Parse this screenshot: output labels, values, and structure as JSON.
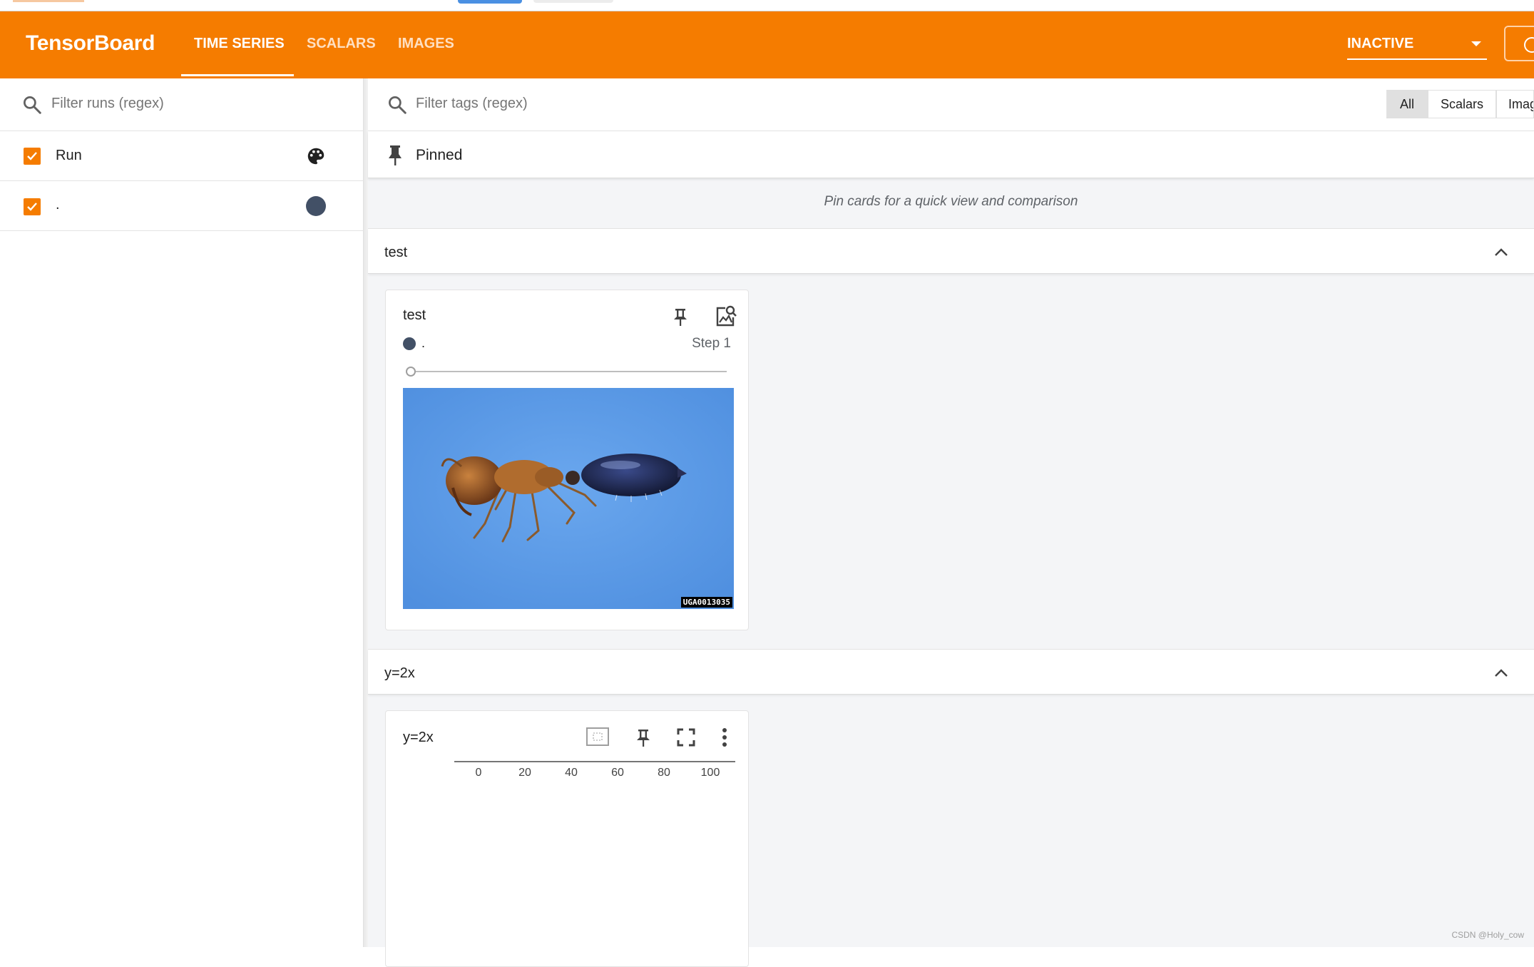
{
  "app": {
    "title": "TensorBoard",
    "tabs": [
      {
        "label": "TIME SERIES",
        "active": true
      },
      {
        "label": "SCALARS",
        "active": false
      },
      {
        "label": "IMAGES",
        "active": false
      }
    ],
    "reload_status": "INACTIVE"
  },
  "sidebar": {
    "filter_placeholder": "Filter runs (regex)",
    "runs": [
      {
        "label": "Run",
        "checked": true,
        "icon": "palette-icon"
      },
      {
        "label": ".",
        "checked": true,
        "color": "#425066"
      }
    ]
  },
  "main": {
    "tag_filter_placeholder": "Filter tags (regex)",
    "type_toggles": [
      {
        "label": "All",
        "selected": true
      },
      {
        "label": "Scalars",
        "selected": false
      },
      {
        "label": "Imag",
        "selected": false
      }
    ],
    "pinned": {
      "title": "Pinned",
      "empty_message": "Pin cards for a quick view and comparison"
    },
    "groups": [
      {
        "title": "test",
        "card": {
          "title": "test",
          "run": ".",
          "step": "Step 1",
          "image_caption": "UGA0013035"
        }
      },
      {
        "title": "y=2x",
        "card": {
          "title": "y=2x",
          "x_ticks": [
            "0",
            "20",
            "40",
            "60",
            "80",
            "100"
          ]
        }
      }
    ]
  },
  "colors": {
    "accent": "#f57c00",
    "run_color": "#425066"
  },
  "watermark": "CSDN @Holy_cow"
}
